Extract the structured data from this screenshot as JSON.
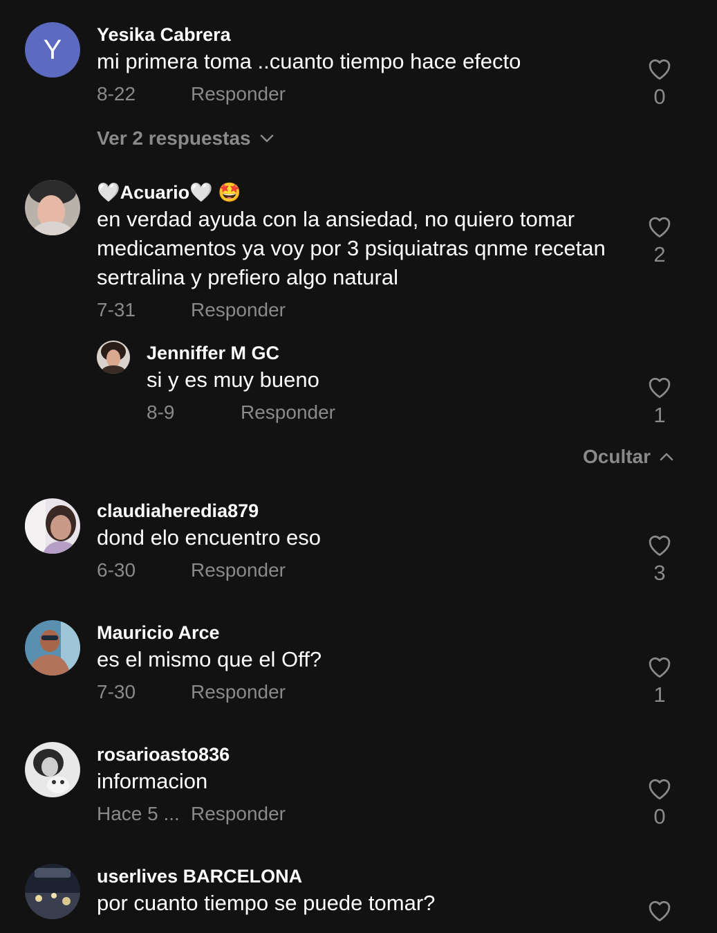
{
  "colors": {
    "background": "#121212",
    "text_primary": "#ffffff",
    "text_secondary": "#8a8a8a",
    "avatar_letter_bg": "#5c6bc0"
  },
  "reply_label": "Responder",
  "comments": [
    {
      "username": "Yesika Cabrera",
      "avatar_letter": "Y",
      "text": "mi primera toma ..cuanto tiempo hace efecto",
      "date": "8-22",
      "likes": "0",
      "replies_toggle": "Ver 2 respuestas"
    },
    {
      "username": "🤍Acuario🤍 🤩",
      "text": "en verdad ayuda con la ansiedad, no quiero tomar medicamentos ya voy por 3 psiquiatras qnme recetan sertralina y prefiero algo natural",
      "date": "7-31",
      "likes": "2",
      "reply": {
        "username": "Jenniffer M GC",
        "text": "si y es muy bueno",
        "date": "8-9",
        "likes": "1"
      },
      "hide_toggle": "Ocultar"
    },
    {
      "username": "claudiaheredia879",
      "text": "dond elo encuentro eso",
      "date": "6-30",
      "likes": "3"
    },
    {
      "username": "Mauricio Arce",
      "text": "es el mismo que el Off?",
      "date": "7-30",
      "likes": "1"
    },
    {
      "username": "rosarioasto836",
      "text": "informacion",
      "date": "Hace 5 ...",
      "likes": "0"
    },
    {
      "username": "userlives BARCELONA",
      "text": "por cuanto tiempo se puede tomar?",
      "likes": ""
    }
  ]
}
